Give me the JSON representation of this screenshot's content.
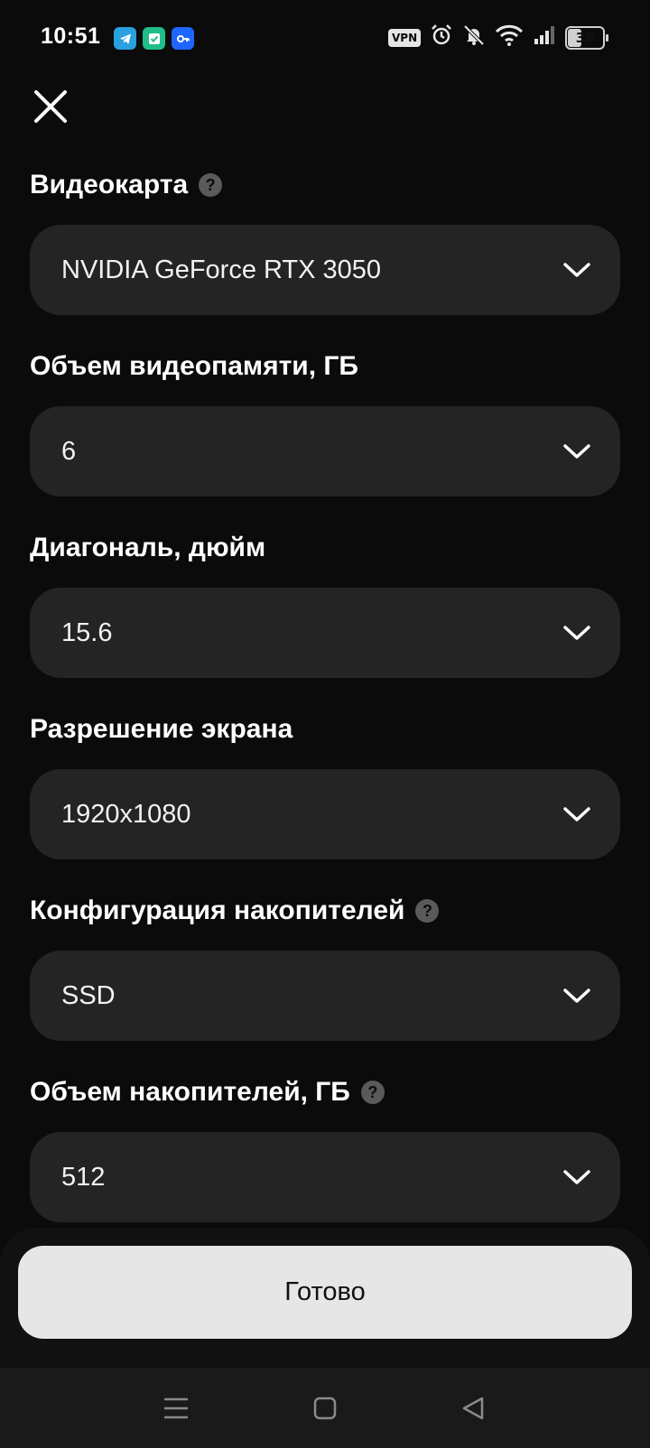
{
  "status_bar": {
    "time": "10:51",
    "vpn_label": "VPN",
    "battery_level": "38",
    "app_icons": [
      "telegram-icon",
      "checklist-icon",
      "key-icon"
    ],
    "system_icons": [
      "vpn-icon",
      "alarm-icon",
      "bell-off-icon",
      "wifi-icon",
      "signal-icon",
      "battery-icon"
    ]
  },
  "header": {
    "close_icon": "close-icon"
  },
  "filters": [
    {
      "label": "Видеокарта",
      "help": "?",
      "value": "NVIDIA GeForce RTX 3050",
      "has_help": true
    },
    {
      "label": "Объем видеопамяти, ГБ",
      "value": "6",
      "has_help": false
    },
    {
      "label": "Диагональ, дюйм",
      "value": "15.6",
      "has_help": false
    },
    {
      "label": "Разрешение экрана",
      "value": "1920x1080",
      "has_help": false
    },
    {
      "label": "Конфигурация накопителей",
      "help": "?",
      "value": "SSD",
      "has_help": true
    },
    {
      "label": "Объем накопителей, ГБ",
      "help": "?",
      "value": "512",
      "has_help": true
    }
  ],
  "footer": {
    "done_label": "Готово"
  },
  "nav_bar": {
    "buttons": [
      "menu-icon",
      "home-square-icon",
      "back-triangle-icon"
    ]
  },
  "colors": {
    "background": "#0b0b0b",
    "field": "#242424",
    "button": "#e6e6e6",
    "help_badge": "#5a5a5a"
  }
}
